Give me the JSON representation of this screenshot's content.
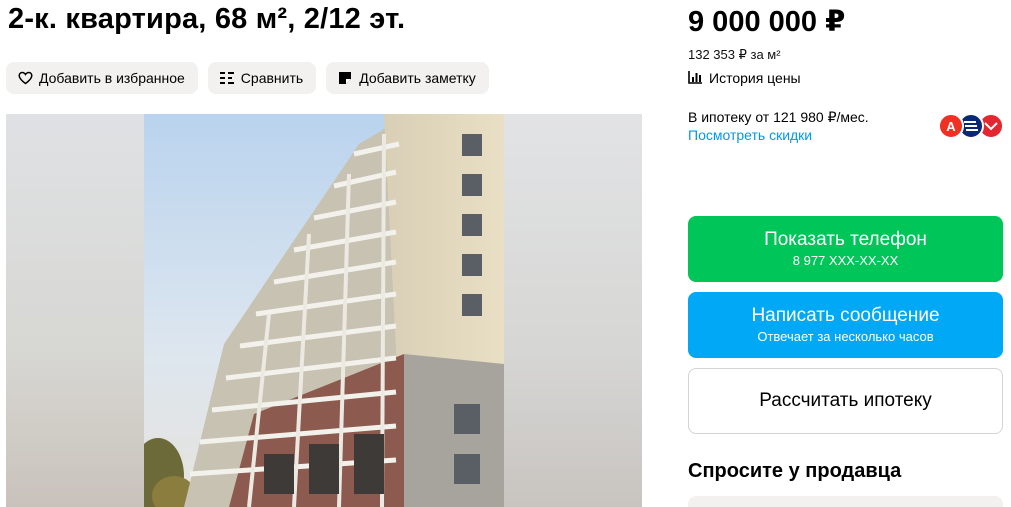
{
  "listing": {
    "title": "2-к. квартира, 68 м², 2/12 эт."
  },
  "actions": {
    "favorite_label": "Добавить в избранное",
    "compare_label": "Сравнить",
    "note_label": "Добавить заметку"
  },
  "pricing": {
    "price": "9 000 000 ₽",
    "per_meter": "132 353 ₽ за м²",
    "history_label": "История цены",
    "mortgage_text": "В ипотеку от 121 980 ₽/мес.",
    "discount_link": "Посмотреть скидки",
    "banks": [
      {
        "name": "alfa",
        "letter": "А",
        "color": "#ef3124"
      },
      {
        "name": "vtb",
        "letter": "",
        "color": "#0a2973"
      },
      {
        "name": "sovcombank",
        "letter": "",
        "color": "#e3262f"
      }
    ]
  },
  "contact": {
    "phone_label": "Показать телефон",
    "phone_masked": "8 977 XXX-XX-XX",
    "message_label": "Написать сообщение",
    "message_sub": "Отвечает за несколько часов",
    "mortgage_calc_label": "Рассчитать ипотеку"
  },
  "seller": {
    "ask_title": "Спросите у продавца"
  },
  "colors": {
    "green": "#00c65a",
    "blue": "#00a8f5",
    "link": "#0099e5",
    "chip_bg": "#f2f1f0"
  }
}
